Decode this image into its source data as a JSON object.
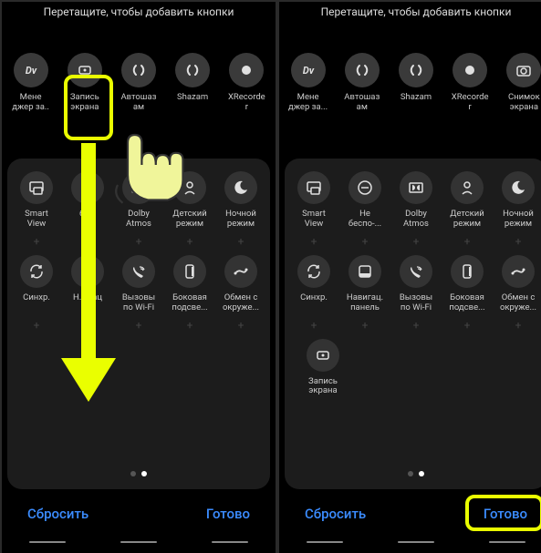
{
  "header": "Перетащите, чтобы добавить кнопки",
  "screen1": {
    "top": [
      {
        "label": "Мене\nджер за..",
        "icon": "dv"
      },
      {
        "label": "Запись\nэкрана",
        "icon": "record"
      },
      {
        "label": "Автошаз\nам",
        "icon": "shazam"
      },
      {
        "label": "Shazam",
        "icon": "shazam"
      },
      {
        "label": "XRecorde\nr",
        "icon": "dot"
      }
    ],
    "panel_row1": [
      {
        "label": "Smart\nView",
        "icon": "smartview"
      },
      {
        "label": "б.....",
        "icon": "dot"
      },
      {
        "label": "Dolby\nAtmos",
        "icon": "dolby"
      },
      {
        "label": "Детский\nрежим",
        "icon": "kids"
      },
      {
        "label": "Ночной\nрежим",
        "icon": "moon"
      }
    ],
    "panel_row2": [
      {
        "label": "Синхр.",
        "icon": "sync"
      },
      {
        "label": "Н..игац\n...",
        "icon": "nav"
      },
      {
        "label": "Вызовы\nпо Wi-Fi",
        "icon": "wificall"
      },
      {
        "label": "Боковая\nподсве...",
        "icon": "edge"
      },
      {
        "label": "Обмен с\nокруже...",
        "icon": "share"
      }
    ]
  },
  "screen2": {
    "top": [
      {
        "label": "Мене\nджер за...",
        "icon": "dv"
      },
      {
        "label": "Автошаз\nам",
        "icon": "shazam"
      },
      {
        "label": "Shazam",
        "icon": "shazam"
      },
      {
        "label": "XRecorde\nr",
        "icon": "dot"
      },
      {
        "label": "Снимок\nэкрана",
        "icon": "camera"
      }
    ],
    "panel_row1": [
      {
        "label": "Smart\nView",
        "icon": "smartview"
      },
      {
        "label": "Не\nбеспо-...",
        "icon": "dnd"
      },
      {
        "label": "Dolby\nAtmos",
        "icon": "dolby"
      },
      {
        "label": "Детский\nрежим",
        "icon": "kids"
      },
      {
        "label": "Ночной\nрежим",
        "icon": "moon"
      }
    ],
    "panel_row2": [
      {
        "label": "Синхр.",
        "icon": "sync"
      },
      {
        "label": "Навигац.\nпанель",
        "icon": "nav"
      },
      {
        "label": "Вызовы\nпо Wi-Fi",
        "icon": "wificall"
      },
      {
        "label": "Боковая\nподсве...",
        "icon": "edge"
      },
      {
        "label": "Обмен с\nокруже...",
        "icon": "share"
      }
    ],
    "panel_row3": [
      {
        "label": "Запись\nэкрана",
        "icon": "record"
      }
    ]
  },
  "buttons": {
    "reset": "Сбросить",
    "done": "Готово"
  },
  "icons": {
    "dv": "<text x='10' y='14' font-size='11' font-weight='bold' fill='#e0e0e0' text-anchor='middle' font-style='italic'>Dv</text>",
    "record": "<rect x='4' y='6' width='12' height='8' rx='2' fill='none' stroke='#e0e0e0' stroke-width='1.5'/><circle cx='10' cy='10' r='1.5' fill='#e0e0e0'/>",
    "shazam": "<path d='M7 5 C4 8 4 12 7 15 M13 5 C16 8 16 12 13 15' stroke='#e0e0e0' stroke-width='2' fill='none' stroke-linecap='round'/>",
    "dot": "<circle cx='10' cy='10' r='5' fill='#e0e0e0'/>",
    "camera": "<rect x='3' y='6' width='14' height='10' rx='2' fill='none' stroke='#e0e0e0' stroke-width='1.5'/><circle cx='10' cy='11' r='3' fill='none' stroke='#e0e0e0' stroke-width='1.5'/>",
    "smartview": "<rect x='3' y='4' width='14' height='10' rx='1.5' fill='none' stroke='#e0e0e0' stroke-width='1.5'/><rect x='7' y='10' width='9' height='7' rx='1' fill='#333' stroke='#e0e0e0' stroke-width='1.5'/>",
    "dnd": "<circle cx='10' cy='10' r='7' fill='none' stroke='#e0e0e0' stroke-width='1.5'/><line x1='6' y1='10' x2='14' y2='10' stroke='#e0e0e0' stroke-width='1.5'/>",
    "dolby": "<rect x='3' y='5' width='14' height='10' rx='1' fill='none' stroke='#e0e0e0' stroke-width='1.5'/><path d='M6 7 A3 3 0 0 1 6 13 M14 7 A3 3 0 0 0 14 13' fill='#e0e0e0'/>",
    "kids": "<circle cx='10' cy='7' r='3' fill='none' stroke='#e0e0e0' stroke-width='1.5'/><path d='M5 17 Q10 12 15 17' fill='none' stroke='#e0e0e0' stroke-width='1.5'/>",
    "moon": "<path d='M12 3 A7 7 0 1 0 17 12 A5 5 0 0 1 12 3' fill='#e0e0e0'/>",
    "sync": "<path d='M4 10 A6 6 0 0 1 15 6 M16 10 A6 6 0 0 1 5 14' fill='none' stroke='#e0e0e0' stroke-width='1.5'/><path d='M15 3 L15 6 L12 6 M5 17 L5 14 L8 14' fill='none' stroke='#e0e0e0' stroke-width='1.5'/>",
    "nav": "<rect x='4' y='4' width='12' height='12' rx='2' fill='none' stroke='#e0e0e0' stroke-width='1.5'/><rect x='4' y='12' width='12' height='4' rx='1' fill='#e0e0e0'/>",
    "wificall": "<path d='M5 5 Q6 10 10 12 Q14 14 15 15 L13 17 Q8 15 5 10 Q3 6 5 5' fill='#e0e0e0'/><path d='M11 5 A5 5 0 0 1 16 8 M12 7 A3 3 0 0 1 15 9' fill='none' stroke='#e0e0e0' stroke-width='1.3'/>",
    "edge": "<rect x='6' y='3' width='8' height='14' rx='2' fill='none' stroke='#e0e0e0' stroke-width='1.5'/><line x1='13' y1='5' x2='13' y2='15' stroke='#e0e0e0' stroke-width='2'/>",
    "share": "<path d='M4 12 Q7 8 11 10 Q15 12 16 8' fill='none' stroke='#e0e0e0' stroke-width='1.8' stroke-linecap='round'/><circle cx='4' cy='12' r='1.5' fill='#e0e0e0'/><circle cx='16' cy='8' r='1.5' fill='#e0e0e0'/>"
  }
}
